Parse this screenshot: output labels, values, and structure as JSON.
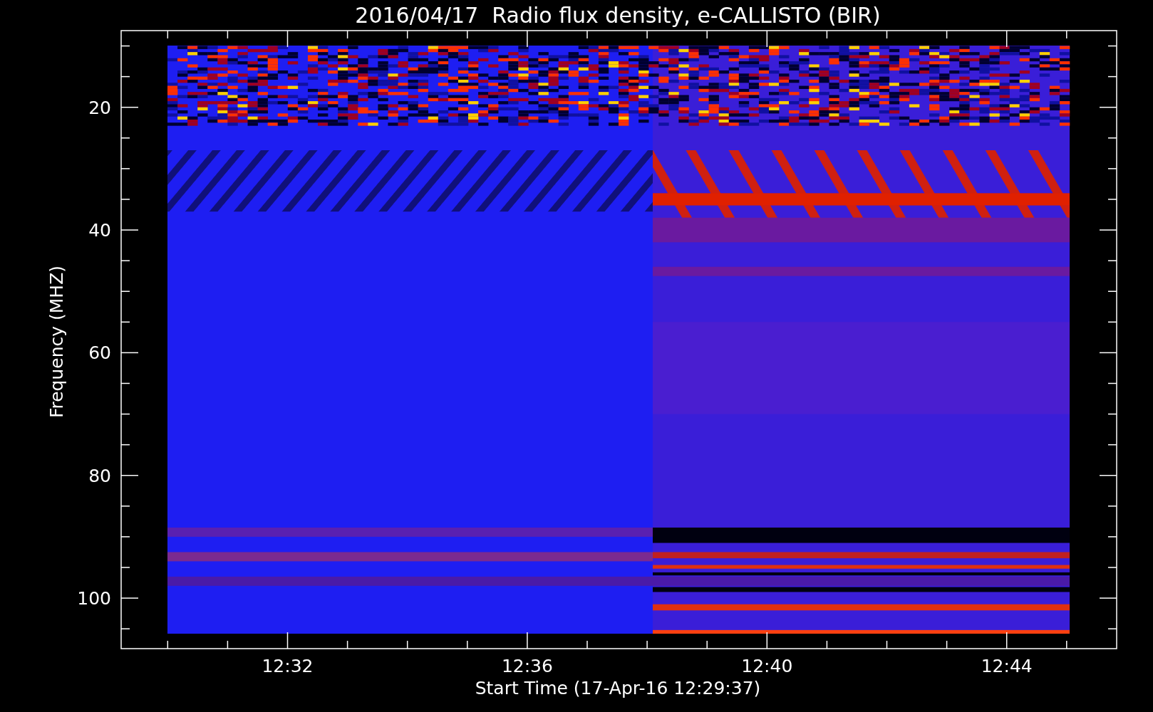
{
  "title": "2016/04/17  Radio flux density, e-CALLISTO (BIR)",
  "y_axis": {
    "label": "Frequency (MHZ)",
    "ticks": [
      "20",
      "40",
      "60",
      "80",
      "100"
    ]
  },
  "x_axis": {
    "label": "Start Time (17-Apr-16 12:29:37)",
    "ticks": [
      "12:32",
      "12:36",
      "12:40",
      "12:44"
    ]
  }
}
